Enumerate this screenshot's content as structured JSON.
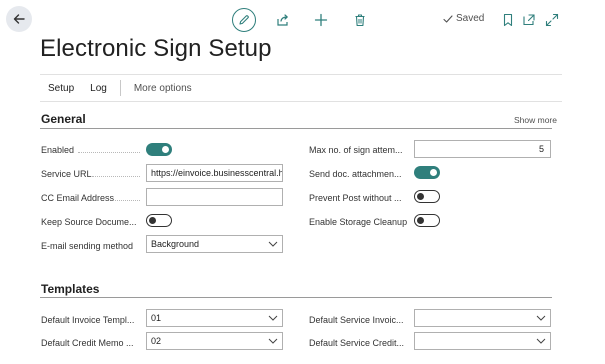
{
  "toolbar": {
    "saved_label": "Saved"
  },
  "page": {
    "title": "Electronic Sign Setup"
  },
  "actions": {
    "setup": "Setup",
    "log": "Log",
    "more_options": "More options"
  },
  "general": {
    "heading": "General",
    "show_more": "Show more",
    "enabled_label": "Enabled",
    "enabled": true,
    "service_url_label": "Service URL",
    "service_url_value": "https://einvoice.businesscentral.hu",
    "cc_email_label": "CC Email Address",
    "cc_email_value": "",
    "keep_source_label": "Keep Source Docume...",
    "keep_source": false,
    "email_method_label": "E-mail sending method",
    "email_method_value": "Background",
    "max_sign_label": "Max no. of sign attem...",
    "max_sign_value": "5",
    "send_doc_label": "Send doc. attachmen...",
    "send_doc": true,
    "prevent_post_label": "Prevent Post without ...",
    "prevent_post": false,
    "storage_cleanup_label": "Enable Storage Cleanup",
    "storage_cleanup": false
  },
  "templates": {
    "heading": "Templates",
    "default_invoice_label": "Default Invoice Templ...",
    "default_invoice_value": "01",
    "default_credit_label": "Default Credit Memo ...",
    "default_credit_value": "02",
    "service_invoice_label": "Default Service Invoic...",
    "service_invoice_value": "",
    "service_credit_label": "Default Service Credit...",
    "service_credit_value": ""
  },
  "colors": {
    "accent": "#2f7f7c",
    "back_button_bg": "#e6e9ee"
  }
}
